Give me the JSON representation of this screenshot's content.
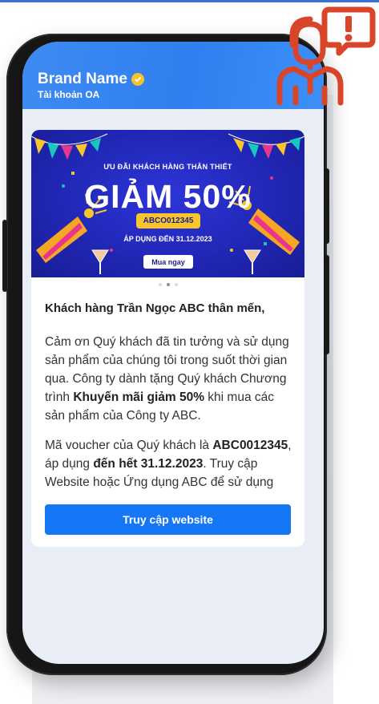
{
  "header": {
    "brand_name": "Brand Name",
    "account_type": "Tài khoản OA"
  },
  "banner": {
    "subtitle": "ƯU ĐÃI KHÁCH HÀNG THÂN THIẾT",
    "title": "GIẢM 50%",
    "code": "ABCO012345",
    "apply": "ÁP DỤNG ĐẾN 31.12.2023",
    "button": "Mua ngay"
  },
  "carousel": {
    "total": 3,
    "active_index": 1
  },
  "message": {
    "greeting": "Khách hàng Trần Ngọc ABC thân mến,",
    "p1_a": "Cảm ơn Quý khách đã tin tưởng và sử dụng sản phẩm của chúng tôi trong suốt thời gian qua. Công ty dành tặng Quý khách Chương trình ",
    "p1_b": "Khuyến mãi giảm 50%",
    "p1_c": " khi mua các sản phẩm của Công ty ABC.",
    "p2_a": "Mã voucher của Quý khách là ",
    "p2_b": "ABC0012345",
    "p2_c": ", áp dụng ",
    "p2_d": "đến hết 31.12.2023",
    "p2_e": ". Truy cập Website hoặc Ứng dụng ABC để sử dụng"
  },
  "cta": {
    "label": "Truy cập website"
  },
  "icons": {
    "verified": "verified-check-icon",
    "report": "agent-alert-icon"
  },
  "colors": {
    "header_blue": "#2f7ff0",
    "cta_blue": "#1677f6",
    "banner_navy": "#2127b6",
    "accent_yellow": "#f8c62c",
    "icon_red": "#d9452b"
  }
}
